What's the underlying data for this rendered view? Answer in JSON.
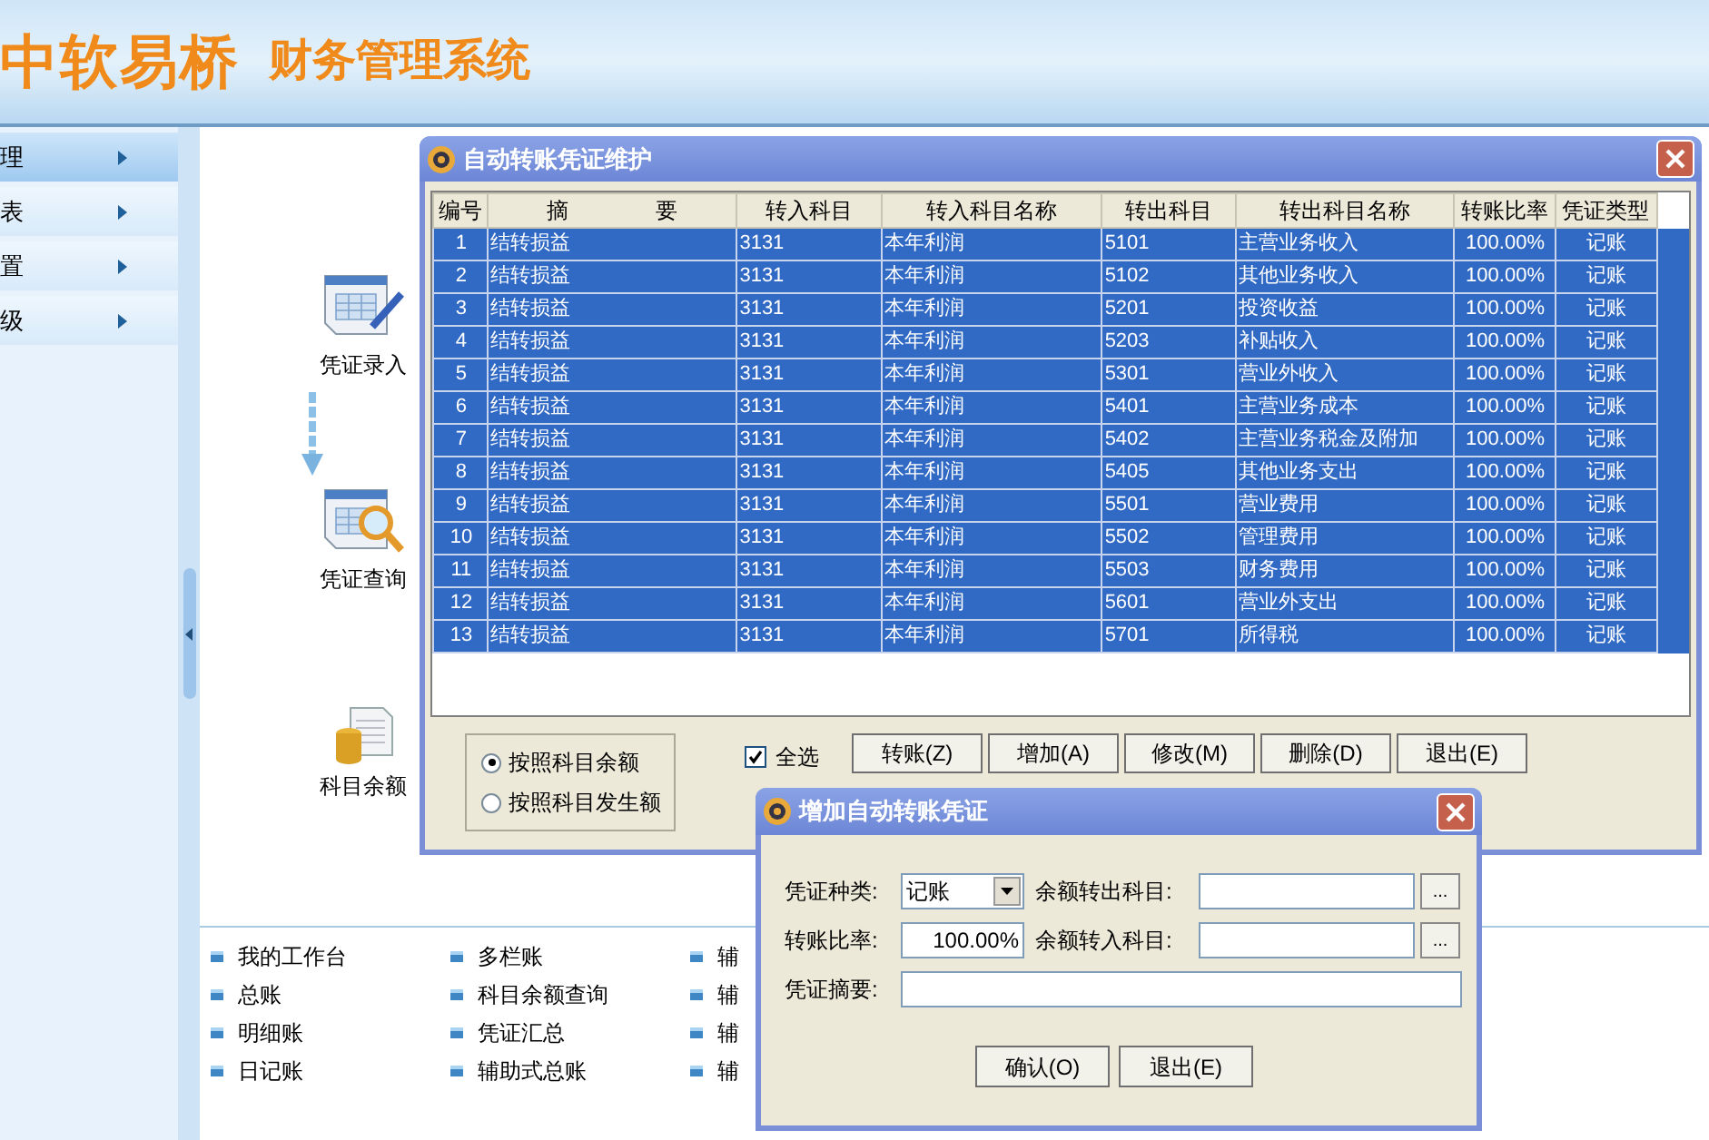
{
  "header": {
    "brand": "中软易桥",
    "product": "财务管理系统"
  },
  "sidebar": {
    "items": [
      {
        "label": "理",
        "selected": true
      },
      {
        "label": "表",
        "selected": false
      },
      {
        "label": "置",
        "selected": false
      },
      {
        "label": "级",
        "selected": false
      }
    ]
  },
  "workflow": [
    {
      "kind": "entry",
      "label": "凭证录入"
    },
    {
      "kind": "query",
      "label": "凭证查询"
    },
    {
      "kind": "balance",
      "label": "科目余额"
    }
  ],
  "links": [
    [
      "我的工作台",
      "总账",
      "明细账",
      "日记账"
    ],
    [
      "多栏账",
      "科目余额查询",
      "凭证汇总",
      "辅助式总账"
    ],
    [
      "辅",
      "辅",
      "辅",
      "辅"
    ]
  ],
  "main_dialog": {
    "title": "自动转账凭证维护",
    "columns": [
      "编号",
      "摘　　　　要",
      "转入科目",
      "转入科目名称",
      "转出科目",
      "转出科目名称",
      "转账比率",
      "凭证类型"
    ],
    "rows": [
      {
        "cells": [
          "1",
          "结转损益",
          "3131",
          "本年利润",
          "5101",
          "主营业务收入",
          "100.00%",
          "记账"
        ],
        "selected": true
      },
      {
        "cells": [
          "2",
          "结转损益",
          "3131",
          "本年利润",
          "5102",
          "其他业务收入",
          "100.00%",
          "记账"
        ],
        "selected": true
      },
      {
        "cells": [
          "3",
          "结转损益",
          "3131",
          "本年利润",
          "5201",
          "投资收益",
          "100.00%",
          "记账"
        ],
        "selected": true
      },
      {
        "cells": [
          "4",
          "结转损益",
          "3131",
          "本年利润",
          "5203",
          "补贴收入",
          "100.00%",
          "记账"
        ],
        "selected": true
      },
      {
        "cells": [
          "5",
          "结转损益",
          "3131",
          "本年利润",
          "5301",
          "营业外收入",
          "100.00%",
          "记账"
        ],
        "selected": true
      },
      {
        "cells": [
          "6",
          "结转损益",
          "3131",
          "本年利润",
          "5401",
          "主营业务成本",
          "100.00%",
          "记账"
        ],
        "selected": true
      },
      {
        "cells": [
          "7",
          "结转损益",
          "3131",
          "本年利润",
          "5402",
          "主营业务税金及附加",
          "100.00%",
          "记账"
        ],
        "selected": true
      },
      {
        "cells": [
          "8",
          "结转损益",
          "3131",
          "本年利润",
          "5405",
          "其他业务支出",
          "100.00%",
          "记账"
        ],
        "selected": true
      },
      {
        "cells": [
          "9",
          "结转损益",
          "3131",
          "本年利润",
          "5501",
          "营业费用",
          "100.00%",
          "记账"
        ],
        "selected": true
      },
      {
        "cells": [
          "10",
          "结转损益",
          "3131",
          "本年利润",
          "5502",
          "管理费用",
          "100.00%",
          "记账"
        ],
        "selected": true
      },
      {
        "cells": [
          "11",
          "结转损益",
          "3131",
          "本年利润",
          "5503",
          "财务费用",
          "100.00%",
          "记账"
        ],
        "selected": true
      },
      {
        "cells": [
          "12",
          "结转损益",
          "3131",
          "本年利润",
          "5601",
          "营业外支出",
          "100.00%",
          "记账"
        ],
        "selected": true
      },
      {
        "cells": [
          "13",
          "结转损益",
          "3131",
          "本年利润",
          "5701",
          "所得税",
          "100.00%",
          "记账"
        ],
        "selected": true
      }
    ],
    "radio_options": [
      {
        "label": "按照科目余额",
        "selected": true
      },
      {
        "label": "按照科目发生额",
        "selected": false
      }
    ],
    "select_all": {
      "label": "全选",
      "checked": true
    },
    "buttons": [
      "转账(Z)",
      "增加(A)",
      "修改(M)",
      "删除(D)",
      "退出(E)"
    ]
  },
  "add_dialog": {
    "title": "增加自动转账凭证",
    "voucher_type": {
      "label": "凭证种类:",
      "value": "记账"
    },
    "rate": {
      "label": "转账比率:",
      "value": "100.00%"
    },
    "out_account": {
      "label": "余额转出科目:",
      "browse": "..."
    },
    "in_account": {
      "label": "余额转入科目:",
      "browse": "..."
    },
    "summary": {
      "label": "凭证摘要:"
    },
    "buttons": [
      "确认(O)",
      "退出(E)"
    ]
  }
}
